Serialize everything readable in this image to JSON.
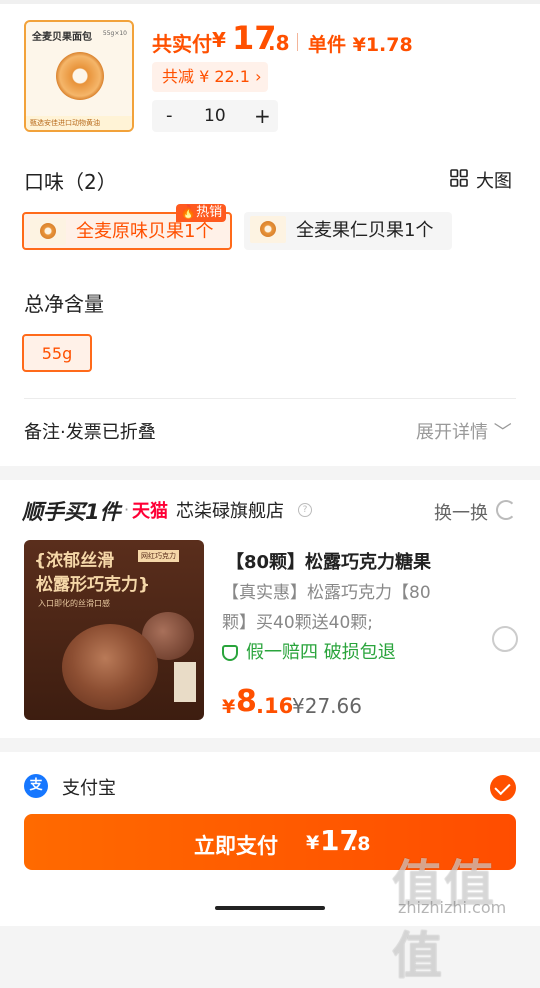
{
  "product": {
    "image_title": "全麦贝果面包",
    "image_spec": "55g×10",
    "image_banner": "甄选安佳进口动物黄油",
    "pay_label": "共实付",
    "currency": "¥",
    "pay_int": "17",
    "pay_dec": ".8",
    "unit_price": "单件 ¥1.78",
    "discount": "共减 ¥ 22.1 ›",
    "qty_minus": "-",
    "quantity": "10",
    "qty_plus": "+"
  },
  "flavor": {
    "title": "口味（2）",
    "big_view": "大图",
    "hot_badge": "🔥热销",
    "options": [
      {
        "label": "全麦原味贝果1个",
        "selected": true
      },
      {
        "label": "全麦果仁贝果1个",
        "selected": false
      }
    ]
  },
  "size": {
    "title": "总净含量",
    "options": [
      {
        "label": "55g",
        "selected": true
      }
    ]
  },
  "remark": {
    "label": "备注·发票已折叠",
    "expand": "展开详情 ﹀"
  },
  "recommend": {
    "brand": "顺手买1件",
    "dot": "·",
    "tmall": "天猫",
    "store": "芯柒碌旗舰店",
    "switch": "换一换",
    "image_headline_1": "{浓郁丝滑",
    "image_headline_2": "松露形巧克力}",
    "image_tag": "网红巧克力",
    "image_sub": "入口即化的丝滑口感",
    "title": "【80颗】松露巧克力糖果",
    "desc": "【真实惠】松露巧克力【80颗】买40颗送40颗;",
    "guarantee": "假一赔四  破损包退",
    "price_yen": "¥",
    "price_int": "8",
    "price_dec": ".16",
    "orig_price": "¥27.66"
  },
  "payment": {
    "method": "支付宝",
    "method_icon": "支",
    "button_label": "立即支付",
    "button_yen": "¥",
    "button_int": "17",
    "button_dec": ".8"
  },
  "watermark": {
    "text": "值值值",
    "url": "zhizhizhi.com"
  }
}
